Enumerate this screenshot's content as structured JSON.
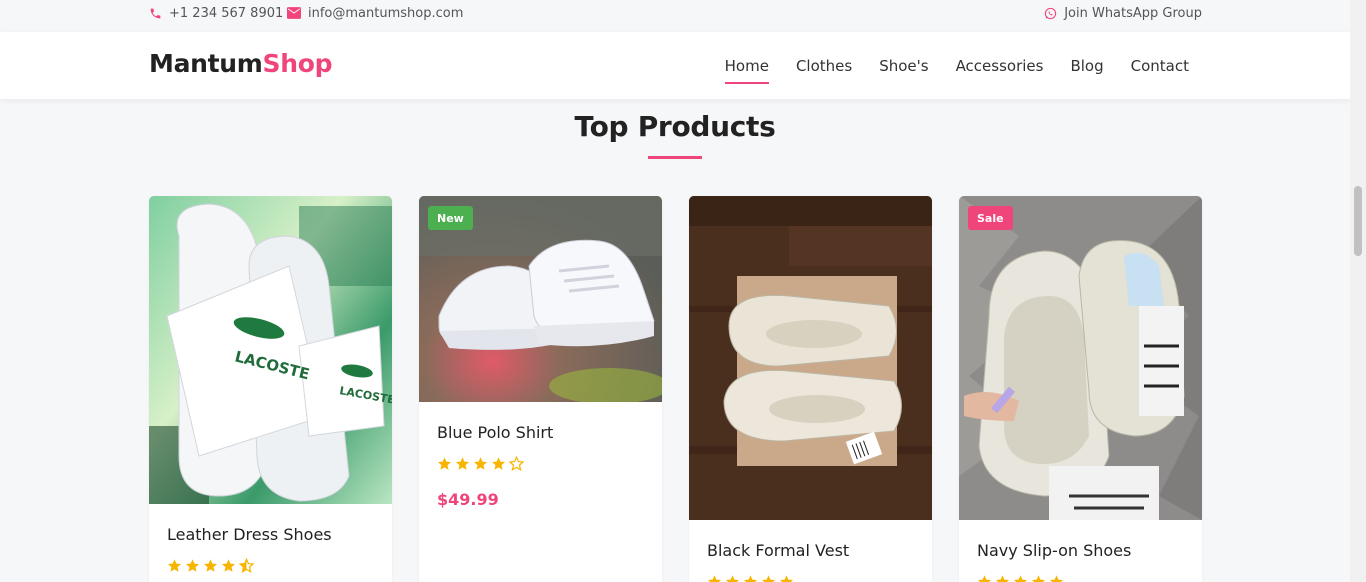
{
  "topbar": {
    "phone": "+1 234 567 8901",
    "email": "info@mantumshop.com",
    "whatsapp": "Join WhatsApp Group"
  },
  "header": {
    "logo_part1": "Mantum",
    "logo_part2": "Shop",
    "nav": [
      "Home",
      "Clothes",
      "Shoe's",
      "Accessories",
      "Blog",
      "Contact"
    ],
    "active_nav": "Home"
  },
  "section": {
    "title": "Top Products"
  },
  "products": [
    {
      "name": "Leather Dress Shoes",
      "rating": 4.5,
      "badge": "",
      "price": ""
    },
    {
      "name": "Blue Polo Shirt",
      "rating": 4,
      "badge": "New",
      "price": "$49.99"
    },
    {
      "name": "Black Formal Vest",
      "rating": 5,
      "badge": "",
      "price": ""
    },
    {
      "name": "Navy Slip-on Shoes",
      "rating": 5,
      "badge": "Sale",
      "price": ""
    }
  ],
  "colors": {
    "accent": "#f0457a",
    "badge_new": "#4caf50",
    "badge_sale": "#f0457a",
    "star": "#f7b500"
  },
  "icons": {
    "phone": "phone-icon",
    "email": "envelope-icon",
    "whatsapp": "whatsapp-icon",
    "star": "star-icon"
  }
}
